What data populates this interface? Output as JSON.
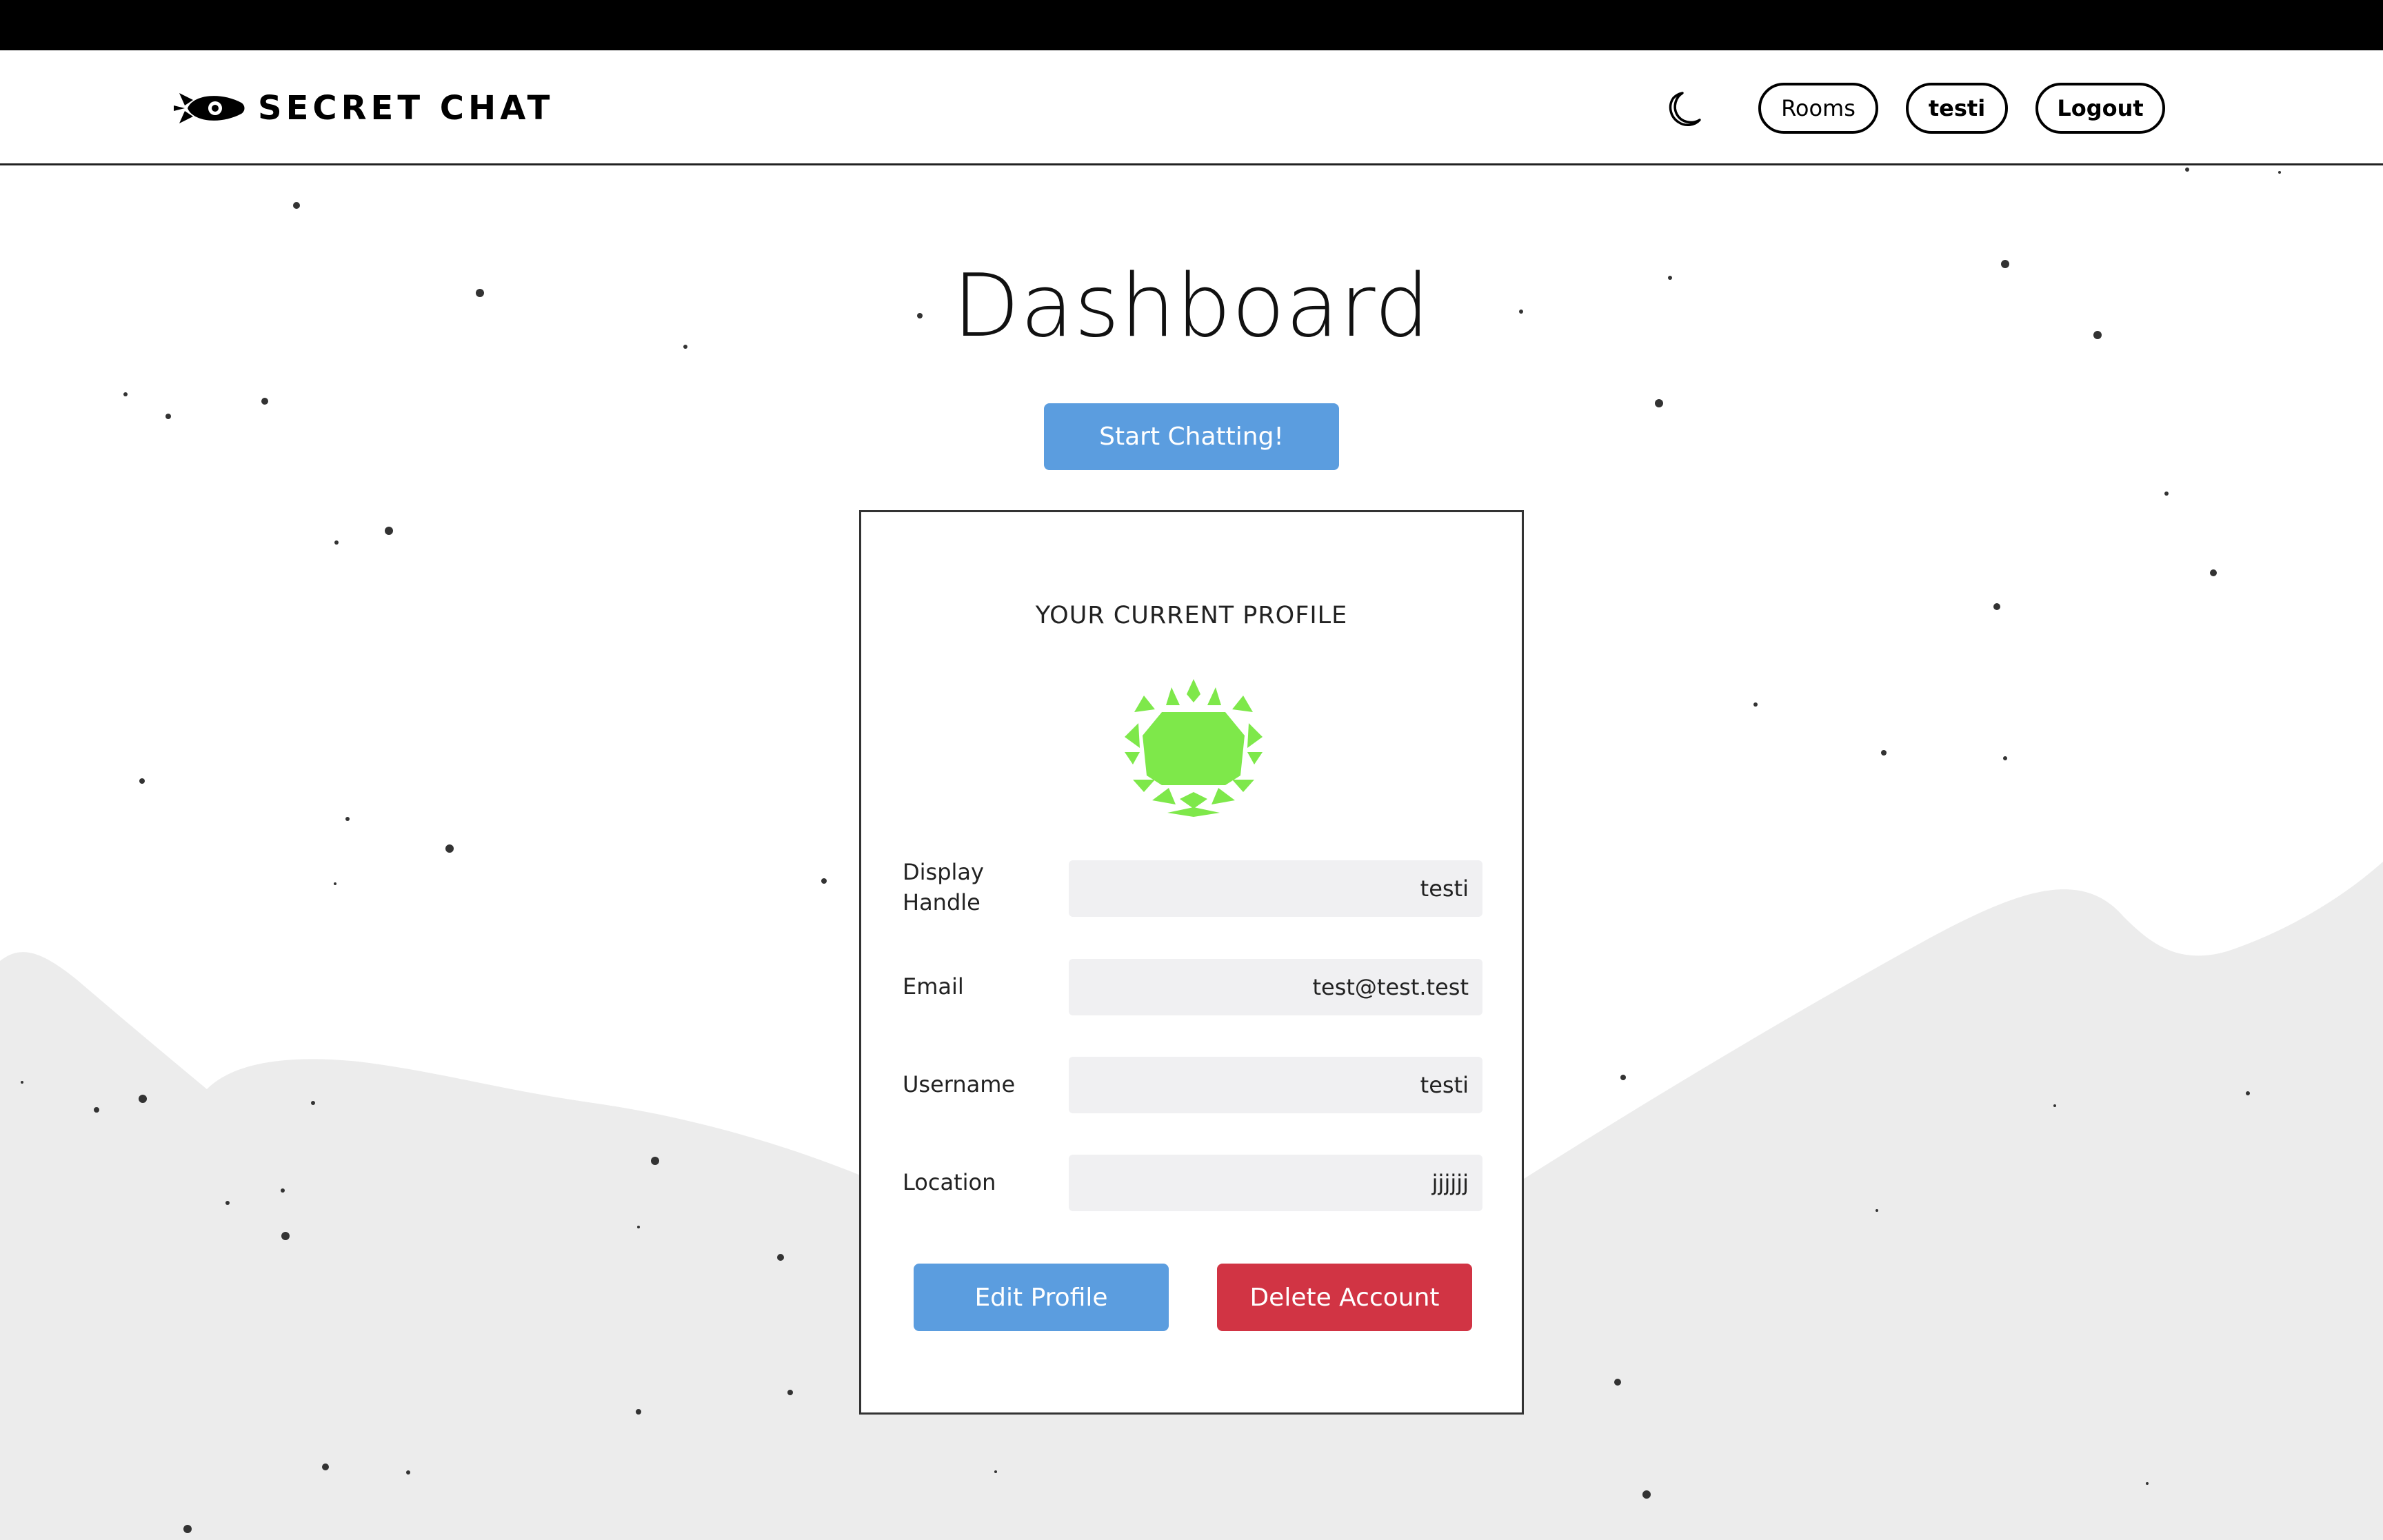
{
  "navbar": {
    "brand": "SECRET CHAT",
    "rooms_label": "Rooms",
    "user_label": "testi",
    "logout_label": "Logout"
  },
  "main": {
    "title": "Dashboard",
    "start_label": "Start Chatting!"
  },
  "profile": {
    "heading": "YOUR CURRENT PROFILE",
    "fields": [
      {
        "label": "Display\nHandle",
        "value": "testi"
      },
      {
        "label": "Email",
        "value": "test@test.test"
      },
      {
        "label": "Username",
        "value": "testi"
      },
      {
        "label": "Location",
        "value": "jjjjjj"
      }
    ],
    "edit_label": "Edit Profile",
    "delete_label": "Delete Account"
  },
  "colors": {
    "primary": "#5b9ddf",
    "danger": "#d13444",
    "avatar": "#7ee84a",
    "hill": "#ececec"
  },
  "icons": {
    "logo": "rocket-logo-icon",
    "theme": "moon-icon",
    "avatar": "identicon-avatar"
  }
}
